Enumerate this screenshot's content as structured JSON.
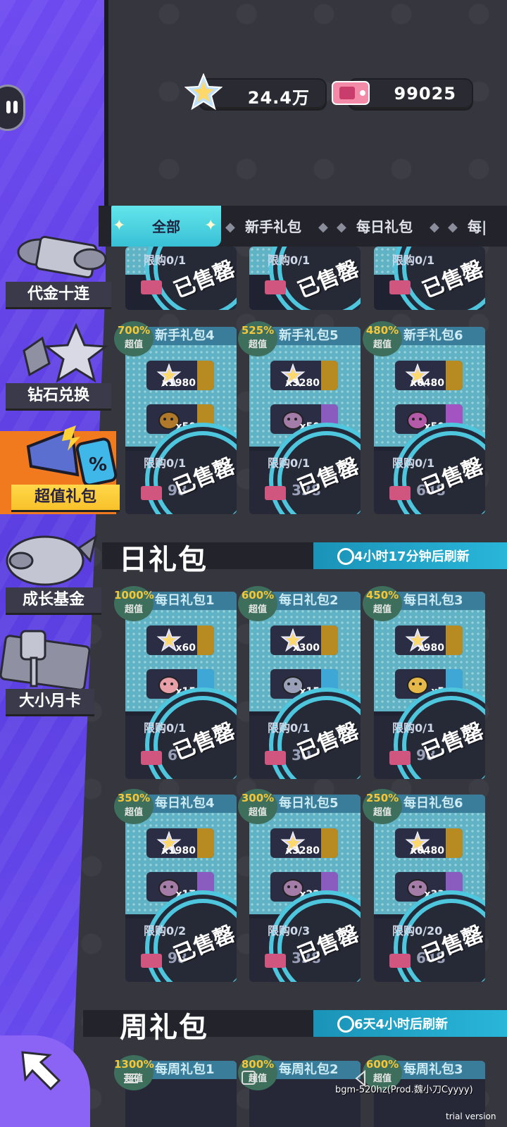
{
  "currency": {
    "stars": "24.4万",
    "tickets": "99025"
  },
  "tabs": [
    "全部",
    "新手礼包",
    "每日礼包",
    "每|"
  ],
  "sidebar": [
    {
      "label": "代金十连"
    },
    {
      "label": "钻石兑换"
    },
    {
      "label": "超值礼包",
      "selected": true
    },
    {
      "label": "成长基金"
    },
    {
      "label": "大小月卡"
    }
  ],
  "top_row": {
    "limit": "限购0/1",
    "sold": "已售罄"
  },
  "novice_row": [
    {
      "badge": "700%",
      "badge_sub": "超值",
      "title": "新手礼包4",
      "qty1": "x1980",
      "qty2": "x50",
      "limit": "限购0/1",
      "price": "98",
      "sold": "已售罄"
    },
    {
      "badge": "525%",
      "badge_sub": "超值",
      "title": "新手礼包5",
      "qty1": "x3280",
      "qty2": "x50",
      "limit": "限购0/1",
      "price": "328",
      "sold": "已售罄"
    },
    {
      "badge": "480%",
      "badge_sub": "超值",
      "title": "新手礼包6",
      "qty1": "x6480",
      "qty2": "x50",
      "limit": "限购0/1",
      "price": "648",
      "sold": "已售罄"
    }
  ],
  "daily": {
    "title": "日礼包",
    "refresh": "4小时17分钟后刷新",
    "cards": [
      {
        "badge": "1000%",
        "badge_sub": "超值",
        "title": "每日礼包1",
        "qty1": "x60",
        "qty2": "x15",
        "limit": "限购0/1",
        "price": "6",
        "sold": "已售罄"
      },
      {
        "badge": "600%",
        "badge_sub": "超值",
        "title": "每日礼包2",
        "qty1": "x300",
        "qty2": "x15",
        "limit": "限购0/1",
        "price": "30",
        "sold": "已售罄"
      },
      {
        "badge": "450%",
        "badge_sub": "超值",
        "title": "每日礼包3",
        "qty1": "x980",
        "qty2": "x5",
        "limit": "限购0/1",
        "price": "98",
        "sold": "已售罄"
      },
      {
        "badge": "350%",
        "badge_sub": "超值",
        "title": "每日礼包4",
        "qty1": "x1980",
        "qty2": "x17",
        "limit": "限购0/2",
        "price": "98",
        "sold": "已售罄"
      },
      {
        "badge": "300%",
        "badge_sub": "超值",
        "title": "每日礼包5",
        "qty1": "x3280",
        "qty2": "x22",
        "limit": "限购0/3",
        "price": "328",
        "sold": "已售罄"
      },
      {
        "badge": "250%",
        "badge_sub": "超值",
        "title": "每日礼包6",
        "qty1": "x6480",
        "qty2": "x33",
        "limit": "限购0/20",
        "price": "648",
        "sold": "已售罄"
      }
    ]
  },
  "weekly": {
    "title": "周礼包",
    "refresh": "6天4小时后刷新",
    "cards": [
      {
        "badge": "1300%",
        "badge_sub": "超值",
        "title": "每周礼包1"
      },
      {
        "badge": "800%",
        "badge_sub": "超值",
        "title": "每周礼包2"
      },
      {
        "badge": "600%",
        "badge_sub": "超值",
        "title": "每周礼包3"
      }
    ]
  },
  "footer": {
    "bgm": "bgm-520hz(Prod.魏小刀Cyyyy)",
    "trial": "trial version"
  }
}
